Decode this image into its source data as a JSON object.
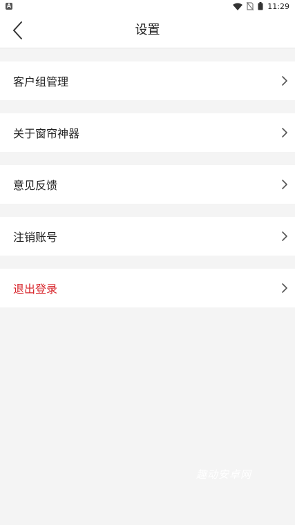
{
  "status_bar": {
    "time": "11:29",
    "badge": "A"
  },
  "header": {
    "title": "设置"
  },
  "menu": [
    {
      "label": "客户组管理"
    },
    {
      "label": "关于窗帘神器"
    },
    {
      "label": "意见反馈"
    },
    {
      "label": "注销账号"
    },
    {
      "label": "退出登录"
    }
  ],
  "colors": {
    "danger": "#d8272d",
    "background": "#f4f4f4"
  },
  "watermark": "趣动安卓网"
}
